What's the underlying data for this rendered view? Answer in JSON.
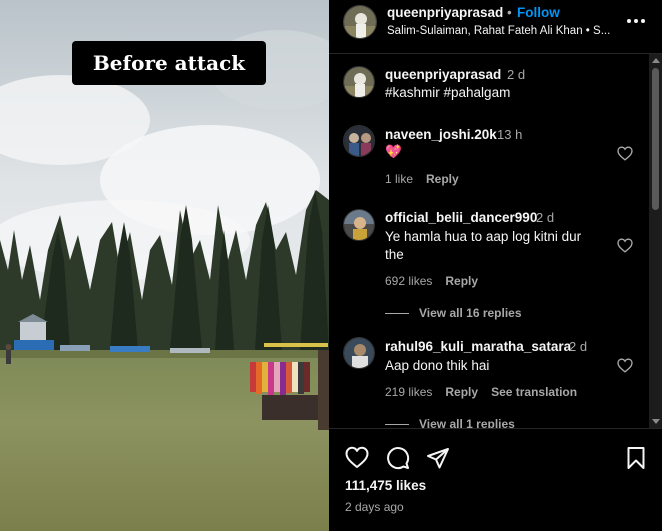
{
  "media": {
    "overlay_text": "Before attack"
  },
  "header": {
    "username": "queenpriyaprasad",
    "separator": "•",
    "follow_label": "Follow",
    "audio": "Salim-Sulaiman, Rahat Fateh Ali Khan • S...",
    "more_icon": "more-horizontal-icon"
  },
  "comments": [
    {
      "username": "queenpriyaprasad",
      "time": "2 d",
      "text": "#kashmir #pahalgam"
    },
    {
      "username": "naveen_joshi.20k",
      "time": "13 h",
      "text": "💖",
      "likes": "1 like",
      "reply_label": "Reply"
    },
    {
      "username": "official_belii_dancer990",
      "time": "2 d",
      "text_line1": "Ye hamla hua to aap log kitni dur",
      "text_line2": "the",
      "likes": "692 likes",
      "reply_label": "Reply",
      "view_replies": "View all 16 replies"
    },
    {
      "username": "rahul96_kuli_maratha_satara",
      "time": "2 d",
      "text": "Aap dono thik hai",
      "likes": "219 likes",
      "reply_label": "Reply",
      "translate_label": "See translation",
      "view_replies": "View all 1 replies"
    }
  ],
  "actions": {
    "like_icon": "heart-icon",
    "comment_icon": "comment-icon",
    "share_icon": "send-icon",
    "save_icon": "bookmark-icon",
    "likes_count": "111,475 likes",
    "date": "2 days ago"
  },
  "colors": {
    "background": "#000000",
    "text": "#f5f5f5",
    "secondary": "#a8a8a8",
    "accent": "#0095f6",
    "divider": "#262626"
  }
}
